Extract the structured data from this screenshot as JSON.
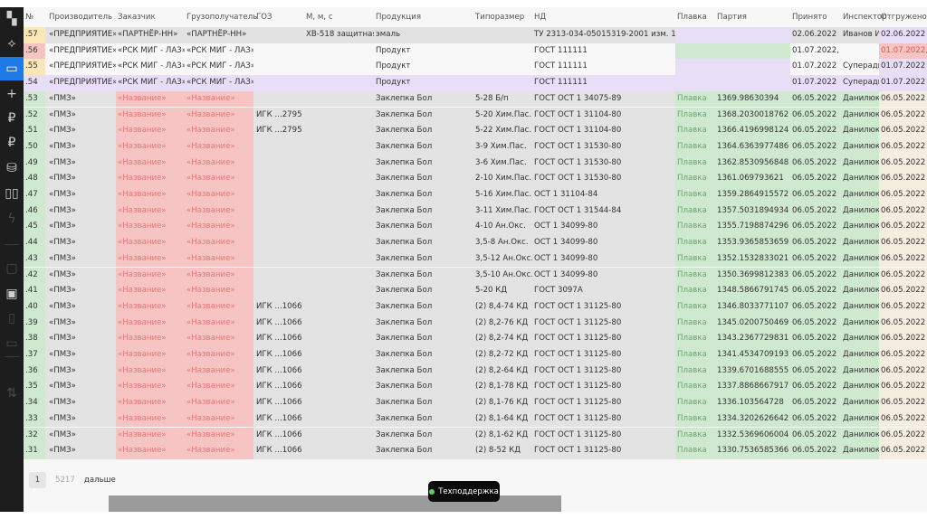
{
  "sidebar": {
    "items": [
      {
        "icon": "dashboard-icon",
        "glyph": "▚",
        "state": "normal"
      },
      {
        "icon": "graph-icon",
        "glyph": "⟡",
        "state": "normal"
      },
      {
        "icon": "monitor-icon",
        "glyph": "▭",
        "state": "active"
      },
      {
        "icon": "plus-icon",
        "glyph": "+",
        "state": "normal"
      },
      {
        "icon": "ruble-icon",
        "glyph": "₽",
        "state": "normal"
      },
      {
        "icon": "ruble-icon",
        "glyph": "₽",
        "state": "normal"
      },
      {
        "icon": "database-icon",
        "glyph": "⛁",
        "state": "normal"
      },
      {
        "icon": "book-icon",
        "glyph": "▯▯",
        "state": "normal"
      },
      {
        "icon": "lightning-icon",
        "glyph": "ϟ",
        "state": "dim"
      },
      {
        "icon": "calendar-icon",
        "glyph": "▢",
        "state": "dim"
      },
      {
        "icon": "window-icon",
        "glyph": "▣",
        "state": "normal"
      },
      {
        "icon": "file-icon",
        "glyph": "▯",
        "state": "dim"
      },
      {
        "icon": "folder-icon",
        "glyph": "▭",
        "state": "dim"
      },
      {
        "icon": "sliders-icon",
        "glyph": "⇅",
        "state": "dim"
      }
    ]
  },
  "colors": {
    "accent": "#1e7ae6",
    "red": "#f7c4c4",
    "green": "#cfe8d0",
    "lavender": "#e9def7",
    "yellow": "#fbe6b7",
    "beige": "#f5ede0",
    "gray": "#e3e3e3"
  },
  "table": {
    "headers": [
      "№",
      "Производитель",
      "Заказчик",
      "Грузополучатель",
      "ГОЗ",
      "М, м, с",
      "Продукция",
      "Типоразмер",
      "НД",
      "Плавка",
      "Партия",
      "Принято",
      "Инспектор",
      "Отгружено"
    ],
    "top_rows": [
      {
        "num": ".57",
        "numColor": "yellow",
        "rowColor": "gray",
        "cells": [
          "«ПРЕДПРИЯТИЕ»",
          "«ПАРТНЁР-НН»",
          "«ПАРТНЁР-НН»",
          "",
          "ХВ-518 защитная",
          "эмаль",
          "",
          "ТУ 2313-034-05015319-2001 изм. 1",
          "",
          "",
          "02.06.2022",
          "Иванов И.",
          "02.06.2022"
        ],
        "meltColor": "lavender",
        "shipColor": "lavender"
      },
      {
        "num": ".56",
        "numColor": "red",
        "rowColor": "white",
        "cells": [
          "«ПРЕДПРИЯТИЕ»",
          "«РСК МИГ - ЛАЗ»",
          "«РСК МИГ - ЛАЗ»",
          "",
          "",
          "Продукт",
          "",
          "ГОСТ 111111",
          "",
          "",
          "01.07.2022,",
          "",
          "01.07.2022,"
        ],
        "meltColor": "green",
        "shipColor": "red"
      },
      {
        "num": ".55",
        "numColor": "yellow",
        "rowColor": "white",
        "cells": [
          "«ПРЕДПРИЯТИЕ»",
          "«РСК МИГ - ЛАЗ»",
          "«РСК МИГ - ЛАЗ»",
          "",
          "",
          "Продукт",
          "",
          "ГОСТ 111111",
          "",
          "",
          "01.07.2022",
          "Суперадми",
          "01.07.2022"
        ],
        "meltColor": "lavender",
        "shipColor": "lavender"
      },
      {
        "num": ".54",
        "numColor": "lavender",
        "rowColor": "lavender",
        "cells": [
          "«ПРЕДПРИЯТИЕ»",
          "«РСК МИГ - ЛАЗ»",
          "«РСК МИГ - ЛАЗ»",
          "",
          "",
          "Продукт",
          "",
          "ГОСТ 111111",
          "",
          "",
          "01.07.2022",
          "Суперадми",
          "01.07.2022"
        ],
        "meltColor": "lavender",
        "shipColor": "lavender"
      }
    ],
    "common": {
      "producer": "«ПМЗ»",
      "customer": "«Название»",
      "consignee": "«Название»",
      "product": "Заклепка Бол",
      "melt": "Плавка",
      "accepted": "06.05.2022",
      "inspector": "Данилюк",
      "shipped": "06.05.2022"
    },
    "rows": [
      {
        "num": ".53",
        "goz": "",
        "size": "5-28 Б/п",
        "nd": "ГОСТ ОСТ 1 34075-89",
        "batch": "1369.98630394"
      },
      {
        "num": ".52",
        "goz": "ИГК ...2795",
        "size": "5-20 Хим.Пас.",
        "nd": "ГОСТ ОСТ 1 31104-80",
        "batch": "1368.2030018762"
      },
      {
        "num": ".51",
        "goz": "ИГК ...2795",
        "size": "5-22 Хим.Пас.",
        "nd": "ГОСТ ОСТ 1 31104-80",
        "batch": "1366.4196998124"
      },
      {
        "num": ".50",
        "goz": "",
        "size": "3-9 Хим.Пас.",
        "nd": "ГОСТ ОСТ 1 31530-80",
        "batch": "1364.6363977486"
      },
      {
        "num": ".49",
        "goz": "",
        "size": "3-6 Хим.Пас.",
        "nd": "ГОСТ ОСТ 1 31530-80",
        "batch": "1362.8530956848"
      },
      {
        "num": ".48",
        "goz": "",
        "size": "2-10 Хим.Пас.",
        "nd": "ГОСТ ОСТ 1 31530-80",
        "batch": "1361.069793621"
      },
      {
        "num": ".47",
        "goz": "",
        "size": "5-16 Хим.Пас.",
        "nd": "ОСТ 1 31104-84",
        "batch": "1359.2864915572"
      },
      {
        "num": ".46",
        "goz": "",
        "size": "3-11 Хим.Пас.",
        "nd": "ГОСТ ОСТ 1 31544-84",
        "batch": "1357.5031894934"
      },
      {
        "num": ".45",
        "goz": "",
        "size": "4-10 Ан.Окс.",
        "nd": "ОСТ 1 34099-80",
        "batch": "1355.7198874296"
      },
      {
        "num": ".44",
        "goz": "",
        "size": "3,5-8 Ан.Окс.",
        "nd": "ОСТ 1 34099-80",
        "batch": "1353.9365853659"
      },
      {
        "num": ".43",
        "goz": "",
        "size": "3,5-12 Ан.Окс.",
        "nd": "ОСТ 1 34099-80",
        "batch": "1352.1532833021"
      },
      {
        "num": ".42",
        "goz": "",
        "size": "3,5-10 Ан.Окс.",
        "nd": "ОСТ 1 34099-80",
        "batch": "1350.3699812383"
      },
      {
        "num": ".41",
        "goz": "",
        "size": "5-20 КД",
        "nd": "ГОСТ 3097А",
        "batch": "1348.5866791745"
      },
      {
        "num": ".40",
        "goz": "ИГК ...1066",
        "size": "(2) 8,4-74 КД",
        "nd": "ГОСТ ОСТ 1 31125-80",
        "batch": "1346.8033771107"
      },
      {
        "num": ".39",
        "goz": "ИГК ...1066",
        "size": "(2) 8,2-76 КД",
        "nd": "ГОСТ ОСТ 1 31125-80",
        "batch": "1345.0200750469"
      },
      {
        "num": ".38",
        "goz": "ИГК ...1066",
        "size": "(2) 8,2-74 КД",
        "nd": "ГОСТ ОСТ 1 31125-80",
        "batch": "1343.2367729831"
      },
      {
        "num": ".37",
        "goz": "ИГК ...1066",
        "size": "(2) 8,2-72 КД",
        "nd": "ГОСТ ОСТ 1 31125-80",
        "batch": "1341.4534709193"
      },
      {
        "num": ".36",
        "goz": "ИГК ...1066",
        "size": "(2) 8,2-64 КД",
        "nd": "ГОСТ ОСТ 1 31125-80",
        "batch": "1339.6701688555"
      },
      {
        "num": ".35",
        "goz": "ИГК ...1066",
        "size": "(2) 8,1-78 КД",
        "nd": "ГОСТ ОСТ 1 31125-80",
        "batch": "1337.8868667917"
      },
      {
        "num": ".34",
        "goz": "ИГК ...1066",
        "size": "(2) 8,1-76 КД",
        "nd": "ГОСТ ОСТ 1 31125-80",
        "batch": "1336.103564728"
      },
      {
        "num": ".33",
        "goz": "ИГК ...1066",
        "size": "(2) 8,1-64 КД",
        "nd": "ГОСТ ОСТ 1 31125-80",
        "batch": "1334.3202626642"
      },
      {
        "num": ".32",
        "goz": "ИГК ...1066",
        "size": "(2) 8,1-62 КД",
        "nd": "ГОСТ ОСТ 1 31125-80",
        "batch": "1332.5369606004"
      },
      {
        "num": ".31",
        "goz": "ИГК ...1066",
        "size": "(2) 8-52 КД",
        "nd": "ГОСТ ОСТ 1 31125-80",
        "batch": "1330.7536585366"
      }
    ]
  },
  "pagination": {
    "current": "1",
    "total": "5217",
    "next": "дальше"
  },
  "support": {
    "label": "Техподдержка"
  }
}
